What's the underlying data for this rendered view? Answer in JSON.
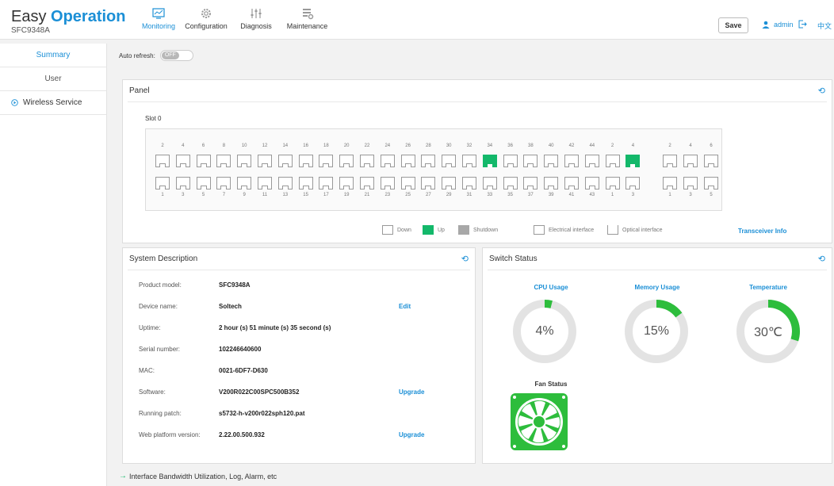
{
  "brand": {
    "title_plain": "Easy ",
    "title_accent": "Operation",
    "device": "SFC9348A"
  },
  "nav": [
    {
      "label": "Monitoring",
      "icon": "monitor-icon",
      "active": true
    },
    {
      "label": "Configuration",
      "icon": "gear-icon",
      "active": false
    },
    {
      "label": "Diagnosis",
      "icon": "sliders-icon",
      "active": false
    },
    {
      "label": "Maintenance",
      "icon": "maintenance-icon",
      "active": false
    }
  ],
  "header": {
    "save_label": "Save",
    "user": "admin",
    "lang": "中文"
  },
  "sidebar": {
    "items": [
      {
        "label": "Summary",
        "active": true
      },
      {
        "label": "User",
        "active": false
      },
      {
        "label": "Wireless Service",
        "active": false
      }
    ]
  },
  "auto_refresh": {
    "label": "Auto refresh:",
    "state": "OFF"
  },
  "panel": {
    "title": "Panel",
    "slot": "Slot 0",
    "top_numbers": [
      "2",
      "4",
      "6",
      "8",
      "10",
      "12",
      "14",
      "16",
      "18",
      "20",
      "22",
      "24",
      "26",
      "28",
      "30",
      "32",
      "34",
      "36",
      "38",
      "40",
      "42",
      "44",
      "2",
      "4"
    ],
    "bottom_numbers": [
      "1",
      "3",
      "5",
      "7",
      "9",
      "11",
      "13",
      "15",
      "17",
      "19",
      "21",
      "23",
      "25",
      "27",
      "29",
      "31",
      "33",
      "35",
      "37",
      "39",
      "41",
      "43",
      "1",
      "3"
    ],
    "extra_top": [
      "2",
      "4",
      "6"
    ],
    "extra_bottom": [
      "1",
      "3",
      "5"
    ],
    "up_ports_top_index": [
      16,
      23
    ],
    "legend": {
      "down": "Down",
      "up": "Up",
      "shutdown": "Shutdown",
      "electrical": "Electrical interface",
      "optical": "Optical interface"
    },
    "transceiver": "Transceiver Info"
  },
  "system_description": {
    "title": "System Description",
    "rows": [
      {
        "key": "Product model:",
        "value": "SFC9348A",
        "link": ""
      },
      {
        "key": "Device name:",
        "value": "Soltech",
        "link": "Edit"
      },
      {
        "key": "Uptime:",
        "value": "2 hour (s) 51 minute (s) 35 second (s)",
        "link": ""
      },
      {
        "key": "Serial number:",
        "value": "102246640600",
        "link": ""
      },
      {
        "key": "MAC:",
        "value": "0021-6DF7-D630",
        "link": ""
      },
      {
        "key": "Software:",
        "value": "V200R022C00SPC500B352",
        "link": "Upgrade"
      },
      {
        "key": "Running patch:",
        "value": "s5732-h-v200r022sph120.pat",
        "link": ""
      },
      {
        "key": "Web platform version:",
        "value": "2.22.00.500.932",
        "link": "Upgrade"
      }
    ]
  },
  "switch_status": {
    "title": "Switch Status",
    "cpu": {
      "label": "CPU Usage",
      "value": "4%",
      "fraction": 0.04
    },
    "memory": {
      "label": "Memory Usage",
      "value": "15%",
      "fraction": 0.15
    },
    "temperature": {
      "label": "Temperature",
      "value": "30℃",
      "fraction": 0.3
    },
    "fan": {
      "label": "Fan Status"
    },
    "colors": {
      "accent": "#1b8fd6",
      "ok": "#2dbd3c",
      "track": "#e3e3e3"
    }
  },
  "footer_link": "Interface Bandwidth Utilization, Log, Alarm, etc"
}
